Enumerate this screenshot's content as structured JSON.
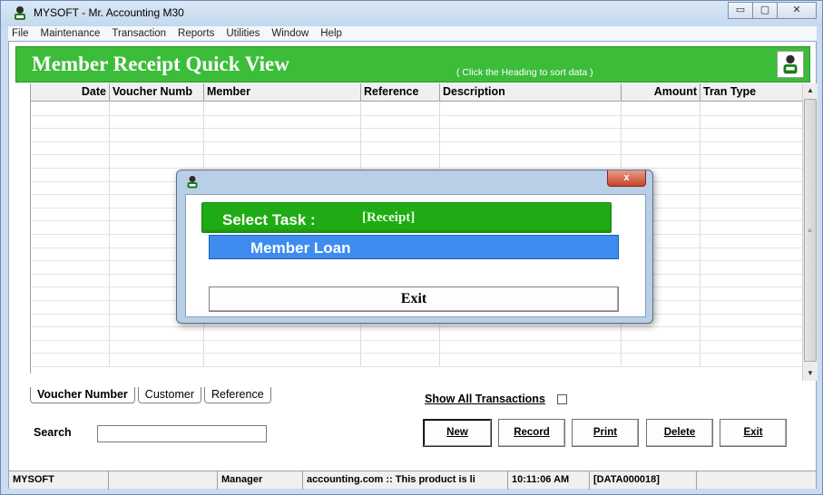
{
  "window": {
    "title": "MYSOFT - Mr. Accounting M30",
    "minimize_glyph": "▭",
    "maximize_glyph": "▢",
    "close_glyph": "✕"
  },
  "menu": [
    "File",
    "Maintenance",
    "Transaction",
    "Reports",
    "Utilities",
    "Window",
    "Help"
  ],
  "header": {
    "title": "Member Receipt Quick View",
    "hint": "( Click the Heading to sort data )",
    "icon": "user-figure-icon"
  },
  "grid": {
    "columns": [
      "Date",
      "Voucher Numb",
      "Member",
      "Reference",
      "Description",
      "Amount",
      "Tran Type"
    ],
    "row_count": 20
  },
  "tabs": [
    "Voucher Number",
    "Customer",
    "Reference"
  ],
  "show_all_label": "Show All Transactions",
  "search": {
    "label": "Search",
    "value": ""
  },
  "buttons": {
    "new": "New",
    "record": "Record",
    "print": "Print",
    "delete": "Delete",
    "exit": "Exit"
  },
  "status": [
    "MYSOFT",
    "",
    "Manager",
    "accounting.com :: This product is li",
    "10:11:06 AM",
    "[DATA000018]",
    ""
  ],
  "dialog": {
    "task_label": "Select  Task :",
    "task_value": "[Receipt]",
    "option": "Member Loan",
    "exit": "Exit",
    "close_glyph": "x"
  },
  "colors": {
    "header_green": "#3cbd3a",
    "task_green": "#1fab14",
    "option_blue": "#3e8cf0"
  }
}
